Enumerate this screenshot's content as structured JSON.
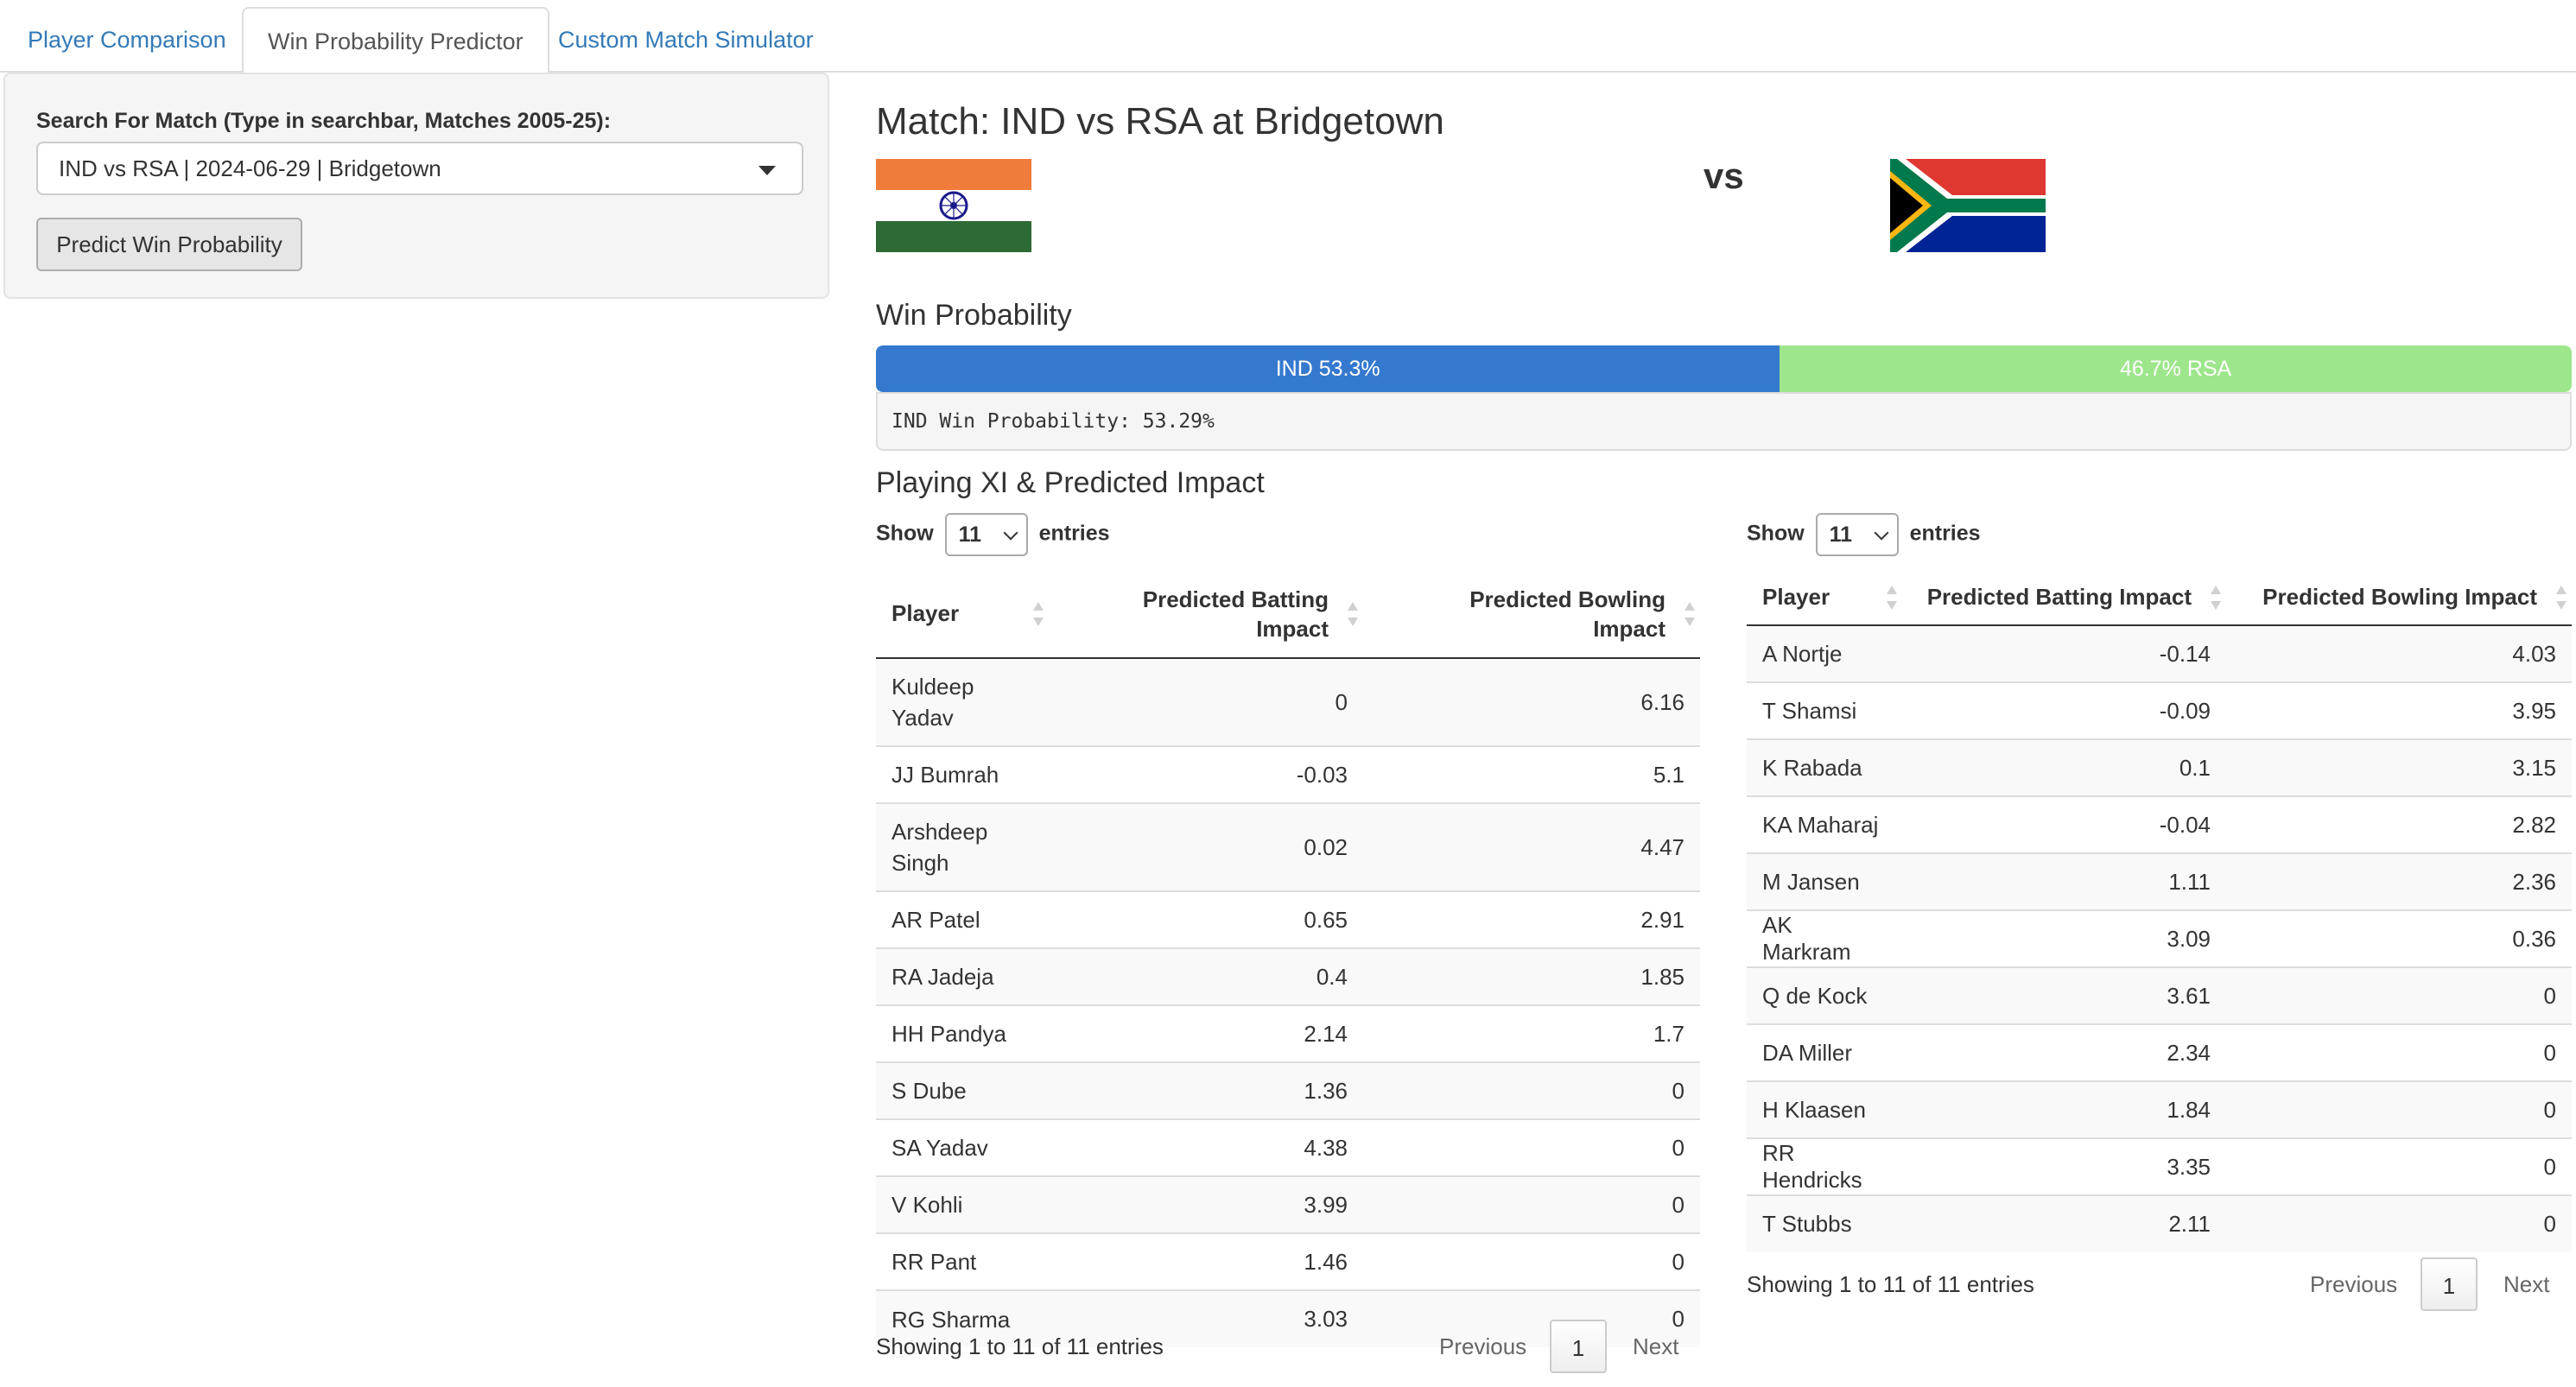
{
  "tabs": [
    "Player Comparison",
    "Win Probability Predictor",
    "Custom Match Simulator"
  ],
  "sidebar": {
    "search_label": "Search For Match (Type in searchbar, Matches 2005-25):",
    "selected_match": "IND vs RSA | 2024-06-29 | Bridgetown",
    "predict_button": "Predict Win Probability"
  },
  "match": {
    "title": "Match: IND vs RSA at Bridgetown",
    "vs": "vs",
    "team1_flag": "india-flag",
    "team2_flag": "south-africa-flag"
  },
  "win_probability": {
    "heading": "Win Probability",
    "team1_label": "IND 53.3%",
    "team2_label": "46.7% RSA",
    "team1_fraction": 0.533,
    "team1_color": "#3579cf",
    "team2_color": "#9de68b",
    "output_text": "IND Win Probability: 53.29%"
  },
  "playing_xi": {
    "heading": "Playing XI & Predicted Impact",
    "left_table": {
      "show": "Show",
      "length_value": "11",
      "entries": "entries",
      "columns": [
        "Player",
        "Predicted Batting Impact",
        "Predicted Bowling Impact"
      ],
      "rows": [
        [
          "Kuldeep Yadav",
          "0",
          "6.16"
        ],
        [
          "JJ Bumrah",
          "-0.03",
          "5.1"
        ],
        [
          "Arshdeep Singh",
          "0.02",
          "4.47"
        ],
        [
          "AR Patel",
          "0.65",
          "2.91"
        ],
        [
          "RA Jadeja",
          "0.4",
          "1.85"
        ],
        [
          "HH Pandya",
          "2.14",
          "1.7"
        ],
        [
          "S Dube",
          "1.36",
          "0"
        ],
        [
          "SA Yadav",
          "4.38",
          "0"
        ],
        [
          "V Kohli",
          "3.99",
          "0"
        ],
        [
          "RR Pant",
          "1.46",
          "0"
        ],
        [
          "RG Sharma",
          "3.03",
          "0"
        ]
      ],
      "info": "Showing 1 to 11 of 11 entries",
      "previous": "Previous",
      "page": "1",
      "next": "Next"
    },
    "right_table": {
      "show": "Show",
      "length_value": "11",
      "entries": "entries",
      "columns": [
        "Player",
        "Predicted Batting Impact",
        "Predicted Bowling Impact"
      ],
      "rows": [
        [
          "A Nortje",
          "-0.14",
          "4.03"
        ],
        [
          "T Shamsi",
          "-0.09",
          "3.95"
        ],
        [
          "K Rabada",
          "0.1",
          "3.15"
        ],
        [
          "KA Maharaj",
          "-0.04",
          "2.82"
        ],
        [
          "M Jansen",
          "1.11",
          "2.36"
        ],
        [
          "AK Markram",
          "3.09",
          "0.36"
        ],
        [
          "Q de Kock",
          "3.61",
          "0"
        ],
        [
          "DA Miller",
          "2.34",
          "0"
        ],
        [
          "H Klaasen",
          "1.84",
          "0"
        ],
        [
          "RR Hendricks",
          "3.35",
          "0"
        ],
        [
          "T Stubbs",
          "2.11",
          "0"
        ]
      ],
      "info": "Showing 1 to 11 of 11 entries",
      "previous": "Previous",
      "page": "1",
      "next": "Next"
    }
  }
}
